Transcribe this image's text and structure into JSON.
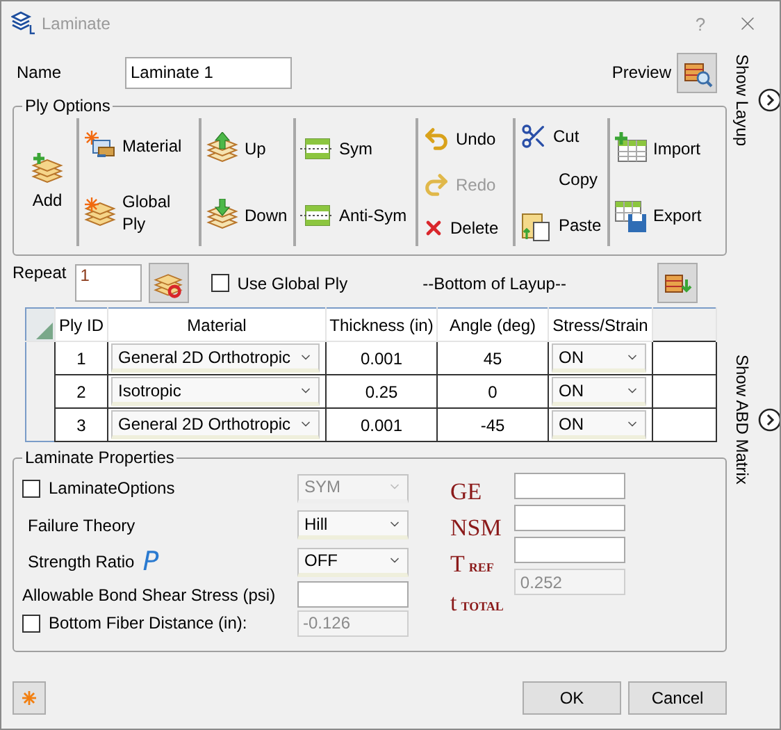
{
  "window": {
    "title": "Laminate",
    "help": "?"
  },
  "name": {
    "label": "Name",
    "value": "Laminate 1"
  },
  "preview": {
    "label": "Preview"
  },
  "side_tabs": [
    "Show Layup",
    "Show ABD Matrix"
  ],
  "ply_options": {
    "title": "Ply Options",
    "groups": [
      {
        "tools": [
          {
            "kind": "add",
            "label": "Add",
            "disabled": false
          }
        ]
      },
      {
        "tools": [
          {
            "kind": "material",
            "label": "Material",
            "disabled": false
          },
          {
            "kind": "global-ply",
            "label": "Global Ply",
            "disabled": false
          }
        ]
      },
      {
        "tools": [
          {
            "kind": "up",
            "label": "Up",
            "disabled": false
          },
          {
            "kind": "down",
            "label": "Down",
            "disabled": false
          }
        ]
      },
      {
        "tools": [
          {
            "kind": "sym",
            "label": "Sym",
            "disabled": false
          },
          {
            "kind": "anti-sym",
            "label": "Anti-Sym",
            "disabled": false
          }
        ]
      },
      {
        "tools": [
          {
            "kind": "undo",
            "label": "Undo",
            "disabled": false
          },
          {
            "kind": "redo",
            "label": "Redo",
            "disabled": true
          },
          {
            "kind": "delete",
            "label": "Delete",
            "disabled": false
          }
        ]
      },
      {
        "tools": [
          {
            "kind": "cut",
            "label": "Cut",
            "disabled": false
          },
          {
            "kind": "copy",
            "label": "Copy",
            "disabled": false
          },
          {
            "kind": "paste",
            "label": "Paste",
            "disabled": false
          }
        ]
      },
      {
        "tools": [
          {
            "kind": "import",
            "label": "Import",
            "disabled": false
          },
          {
            "kind": "export",
            "label": "Export",
            "disabled": false
          }
        ]
      }
    ]
  },
  "repeat": {
    "label": "Repeat",
    "value": "1"
  },
  "use_global_ply": {
    "label": "Use Global Ply",
    "checked": false
  },
  "layup_position": "--Bottom of Layup--",
  "table": {
    "columns": [
      "Ply ID",
      "Material",
      "Thickness (in)",
      "Angle (deg)",
      "Stress/Strain"
    ],
    "rows": [
      {
        "ply_id": "1",
        "material": "General 2D Orthotropic",
        "thickness": "0.001",
        "angle": "45",
        "stress_strain": "ON"
      },
      {
        "ply_id": "2",
        "material": "Isotropic",
        "thickness": "0.25",
        "angle": "0",
        "stress_strain": "ON"
      },
      {
        "ply_id": "3",
        "material": "General 2D Orthotropic",
        "thickness": "0.001",
        "angle": "-45",
        "stress_strain": "ON"
      }
    ]
  },
  "properties": {
    "title": "Laminate Properties",
    "laminate_options": {
      "label": "LaminateOptions",
      "checked": false,
      "value": "SYM",
      "disabled": true
    },
    "failure_theory": {
      "label": "Failure Theory",
      "value": "Hill"
    },
    "strength_ratio": {
      "label": "Strength Ratio",
      "symbol": "P",
      "value": "OFF"
    },
    "allowable_bond_shear": {
      "label": "Allowable Bond Shear Stress (psi)"
    },
    "bottom_fiber": {
      "label": "Bottom Fiber Distance (in):",
      "checked": false,
      "value": "-0.126"
    },
    "params": [
      {
        "label": "GE"
      },
      {
        "label": "NSM"
      },
      {
        "label": "T$_{REF}$"
      },
      {
        "label": "t$_{TOTAL}$"
      }
    ],
    "param_fields": [
      {
        "disabled": false
      },
      {
        "disabled": false
      },
      {
        "disabled": false
      },
      {
        "value": "0.252",
        "disabled": true
      }
    ]
  },
  "buttons": {
    "ok": "OK",
    "cancel": "Cancel"
  }
}
